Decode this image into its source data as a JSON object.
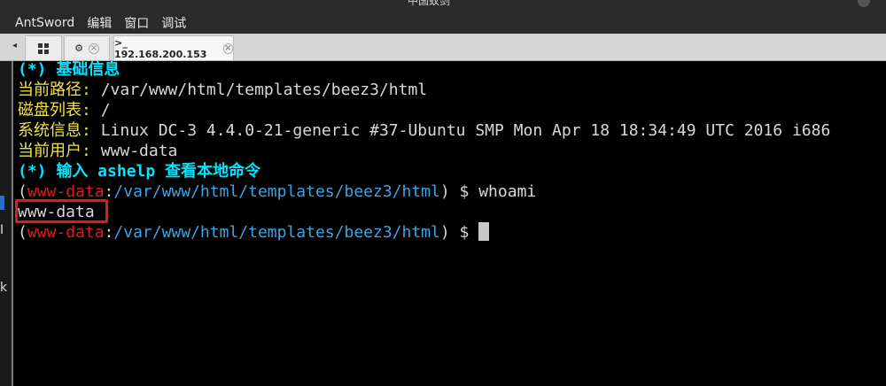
{
  "window": {
    "title": "中国蚁剑"
  },
  "menubar": {
    "items": [
      "AntSword",
      "编辑",
      "窗口",
      "调试"
    ]
  },
  "tabs": {
    "arrow": "◂",
    "settings_close": "×",
    "terminal_label": ">_ 192.168.200.153",
    "terminal_close": "×"
  },
  "gutter": {
    "k1": "I",
    "k2": "k"
  },
  "terminal": {
    "line1": "(*) 基础信息",
    "line2_label": "当前路径: ",
    "line2_value": "/var/www/html/templates/beez3/html",
    "line3_label": "磁盘列表: ",
    "line3_value": "/",
    "line4_label": "系统信息: ",
    "line4_value": "Linux DC-3 4.4.0-21-generic #37-Ubuntu SMP Mon Apr 18 18:34:49 UTC 2016 i686",
    "line5_label": "当前用户: ",
    "line5_value": "www-data",
    "line6": "(*) 输入 ashelp 查看本地命令",
    "prompt_open": "(",
    "prompt_user": "www-data",
    "prompt_colon": ":",
    "prompt_path": "/var/www/html/templates/beez3/html",
    "prompt_close": ") $ ",
    "command": "whoami",
    "output": "www-data"
  }
}
